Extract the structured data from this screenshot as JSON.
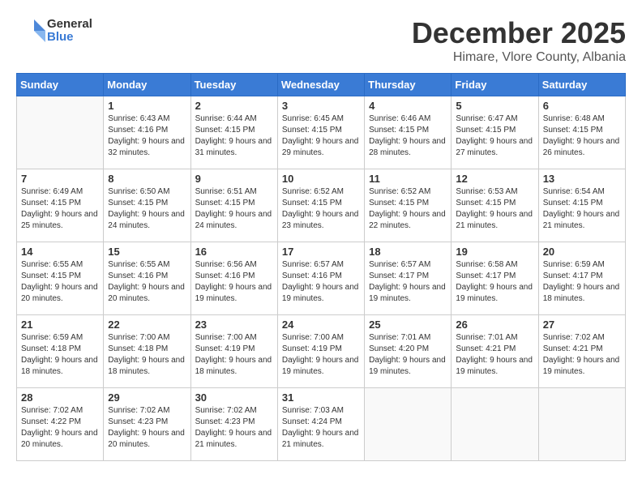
{
  "logo": {
    "general": "General",
    "blue": "Blue"
  },
  "header": {
    "month_year": "December 2025",
    "location": "Himare, Vlore County, Albania"
  },
  "days_of_week": [
    "Sunday",
    "Monday",
    "Tuesday",
    "Wednesday",
    "Thursday",
    "Friday",
    "Saturday"
  ],
  "weeks": [
    [
      {
        "day": "",
        "sunrise": "",
        "sunset": "",
        "daylight": ""
      },
      {
        "day": "1",
        "sunrise": "Sunrise: 6:43 AM",
        "sunset": "Sunset: 4:16 PM",
        "daylight": "Daylight: 9 hours and 32 minutes."
      },
      {
        "day": "2",
        "sunrise": "Sunrise: 6:44 AM",
        "sunset": "Sunset: 4:15 PM",
        "daylight": "Daylight: 9 hours and 31 minutes."
      },
      {
        "day": "3",
        "sunrise": "Sunrise: 6:45 AM",
        "sunset": "Sunset: 4:15 PM",
        "daylight": "Daylight: 9 hours and 29 minutes."
      },
      {
        "day": "4",
        "sunrise": "Sunrise: 6:46 AM",
        "sunset": "Sunset: 4:15 PM",
        "daylight": "Daylight: 9 hours and 28 minutes."
      },
      {
        "day": "5",
        "sunrise": "Sunrise: 6:47 AM",
        "sunset": "Sunset: 4:15 PM",
        "daylight": "Daylight: 9 hours and 27 minutes."
      },
      {
        "day": "6",
        "sunrise": "Sunrise: 6:48 AM",
        "sunset": "Sunset: 4:15 PM",
        "daylight": "Daylight: 9 hours and 26 minutes."
      }
    ],
    [
      {
        "day": "7",
        "sunrise": "Sunrise: 6:49 AM",
        "sunset": "Sunset: 4:15 PM",
        "daylight": "Daylight: 9 hours and 25 minutes."
      },
      {
        "day": "8",
        "sunrise": "Sunrise: 6:50 AM",
        "sunset": "Sunset: 4:15 PM",
        "daylight": "Daylight: 9 hours and 24 minutes."
      },
      {
        "day": "9",
        "sunrise": "Sunrise: 6:51 AM",
        "sunset": "Sunset: 4:15 PM",
        "daylight": "Daylight: 9 hours and 24 minutes."
      },
      {
        "day": "10",
        "sunrise": "Sunrise: 6:52 AM",
        "sunset": "Sunset: 4:15 PM",
        "daylight": "Daylight: 9 hours and 23 minutes."
      },
      {
        "day": "11",
        "sunrise": "Sunrise: 6:52 AM",
        "sunset": "Sunset: 4:15 PM",
        "daylight": "Daylight: 9 hours and 22 minutes."
      },
      {
        "day": "12",
        "sunrise": "Sunrise: 6:53 AM",
        "sunset": "Sunset: 4:15 PM",
        "daylight": "Daylight: 9 hours and 21 minutes."
      },
      {
        "day": "13",
        "sunrise": "Sunrise: 6:54 AM",
        "sunset": "Sunset: 4:15 PM",
        "daylight": "Daylight: 9 hours and 21 minutes."
      }
    ],
    [
      {
        "day": "14",
        "sunrise": "Sunrise: 6:55 AM",
        "sunset": "Sunset: 4:15 PM",
        "daylight": "Daylight: 9 hours and 20 minutes."
      },
      {
        "day": "15",
        "sunrise": "Sunrise: 6:55 AM",
        "sunset": "Sunset: 4:16 PM",
        "daylight": "Daylight: 9 hours and 20 minutes."
      },
      {
        "day": "16",
        "sunrise": "Sunrise: 6:56 AM",
        "sunset": "Sunset: 4:16 PM",
        "daylight": "Daylight: 9 hours and 19 minutes."
      },
      {
        "day": "17",
        "sunrise": "Sunrise: 6:57 AM",
        "sunset": "Sunset: 4:16 PM",
        "daylight": "Daylight: 9 hours and 19 minutes."
      },
      {
        "day": "18",
        "sunrise": "Sunrise: 6:57 AM",
        "sunset": "Sunset: 4:17 PM",
        "daylight": "Daylight: 9 hours and 19 minutes."
      },
      {
        "day": "19",
        "sunrise": "Sunrise: 6:58 AM",
        "sunset": "Sunset: 4:17 PM",
        "daylight": "Daylight: 9 hours and 19 minutes."
      },
      {
        "day": "20",
        "sunrise": "Sunrise: 6:59 AM",
        "sunset": "Sunset: 4:17 PM",
        "daylight": "Daylight: 9 hours and 18 minutes."
      }
    ],
    [
      {
        "day": "21",
        "sunrise": "Sunrise: 6:59 AM",
        "sunset": "Sunset: 4:18 PM",
        "daylight": "Daylight: 9 hours and 18 minutes."
      },
      {
        "day": "22",
        "sunrise": "Sunrise: 7:00 AM",
        "sunset": "Sunset: 4:18 PM",
        "daylight": "Daylight: 9 hours and 18 minutes."
      },
      {
        "day": "23",
        "sunrise": "Sunrise: 7:00 AM",
        "sunset": "Sunset: 4:19 PM",
        "daylight": "Daylight: 9 hours and 18 minutes."
      },
      {
        "day": "24",
        "sunrise": "Sunrise: 7:00 AM",
        "sunset": "Sunset: 4:19 PM",
        "daylight": "Daylight: 9 hours and 19 minutes."
      },
      {
        "day": "25",
        "sunrise": "Sunrise: 7:01 AM",
        "sunset": "Sunset: 4:20 PM",
        "daylight": "Daylight: 9 hours and 19 minutes."
      },
      {
        "day": "26",
        "sunrise": "Sunrise: 7:01 AM",
        "sunset": "Sunset: 4:21 PM",
        "daylight": "Daylight: 9 hours and 19 minutes."
      },
      {
        "day": "27",
        "sunrise": "Sunrise: 7:02 AM",
        "sunset": "Sunset: 4:21 PM",
        "daylight": "Daylight: 9 hours and 19 minutes."
      }
    ],
    [
      {
        "day": "28",
        "sunrise": "Sunrise: 7:02 AM",
        "sunset": "Sunset: 4:22 PM",
        "daylight": "Daylight: 9 hours and 20 minutes."
      },
      {
        "day": "29",
        "sunrise": "Sunrise: 7:02 AM",
        "sunset": "Sunset: 4:23 PM",
        "daylight": "Daylight: 9 hours and 20 minutes."
      },
      {
        "day": "30",
        "sunrise": "Sunrise: 7:02 AM",
        "sunset": "Sunset: 4:23 PM",
        "daylight": "Daylight: 9 hours and 21 minutes."
      },
      {
        "day": "31",
        "sunrise": "Sunrise: 7:03 AM",
        "sunset": "Sunset: 4:24 PM",
        "daylight": "Daylight: 9 hours and 21 minutes."
      },
      {
        "day": "",
        "sunrise": "",
        "sunset": "",
        "daylight": ""
      },
      {
        "day": "",
        "sunrise": "",
        "sunset": "",
        "daylight": ""
      },
      {
        "day": "",
        "sunrise": "",
        "sunset": "",
        "daylight": ""
      }
    ]
  ]
}
